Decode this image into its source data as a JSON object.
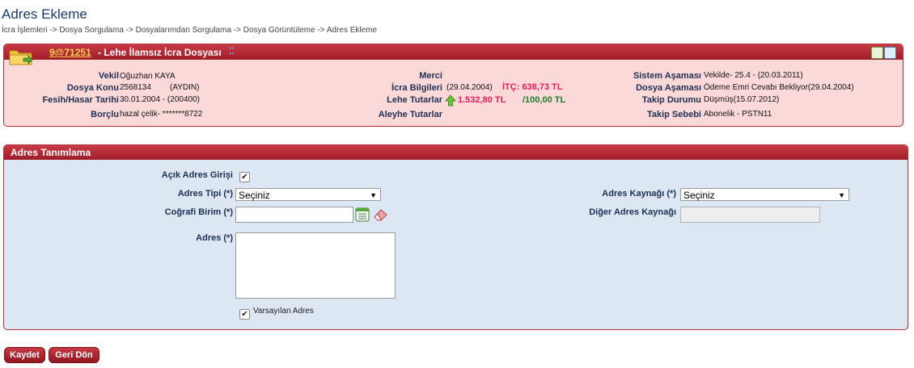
{
  "page": {
    "title": "Adres Ekleme",
    "breadcrumb": "İcra İşlemleri -> Dosya Sorgulama -> Dosyalarımdan Sorgulama -> Dosya Görüntüleme -> Adres Ekleme"
  },
  "file_panel": {
    "file_no": "9@71251",
    "file_type": "- Lehe İlamsız İcra Dosyası",
    "dots": "⁚⁚",
    "vekil_label": "Vekil",
    "vekil_value": "Oğuzhan KAYA",
    "dosya_konu_label": "Dosya Konu",
    "dosya_konu_value": "2568134",
    "dosya_konu_city": "(AYDIN)",
    "fesih_label": "Fesih/Hasar Tarihi",
    "fesih_value": "30.01.2004 - (200400)",
    "borclu_label": "Borçlu",
    "borclu_value": "hazal çelik- *******8722",
    "merci_label": "Merci",
    "icra_bilgileri_label": "İcra Bilgileri",
    "icra_bilgileri_date": "(29.04.2004)",
    "icra_bilgileri_itc": "İTÇ: 638,73 TL",
    "lehe_tutarlar_label": "Lehe Tutarlar",
    "lehe_tutar_red": "1.532,80 TL",
    "lehe_tutar_green": "/100,00 TL",
    "aleyhe_tutarlar_label": "Aleyhe Tutarlar",
    "sistem_asamasi_label": "Sistem Aşaması",
    "sistem_asamasi_value": "Vekilde- 25.4 - (20.03.2011)",
    "dosya_asamasi_label": "Dosya Aşaması",
    "dosya_asamasi_value": "Ödeme Emri Cevabı Bekliyor(29.04.2004)",
    "takip_durumu_label": "Takip Durumu",
    "takip_durumu_value": "Düşmüş(15.07.2012)",
    "takip_sebebi_label": "Takip Sebebi",
    "takip_sebebi_value": "Abonelik - PSTN11"
  },
  "form": {
    "header": "Adres Tanımlama",
    "acik_adres_label": "Açık Adres Girişi",
    "acik_adres_checked": true,
    "adres_tipi_label": "Adres Tipi (*)",
    "adres_tipi_value": "Seçiniz",
    "cografi_birim_label": "Coğrafi Birim (*)",
    "cografi_birim_value": "",
    "adres_label": "Adres (*)",
    "adres_value": "",
    "varsayilan_label": "Varsayılan Adres",
    "varsayilan_checked": true,
    "adres_kaynagi_label": "Adres Kaynağı (*)",
    "adres_kaynagi_value": "Seçiniz",
    "diger_kaynak_label": "Diğer Adres Kaynağı",
    "diger_kaynak_value": ""
  },
  "buttons": {
    "kaydet": "Kaydet",
    "geri_don": "Geri Dön"
  }
}
